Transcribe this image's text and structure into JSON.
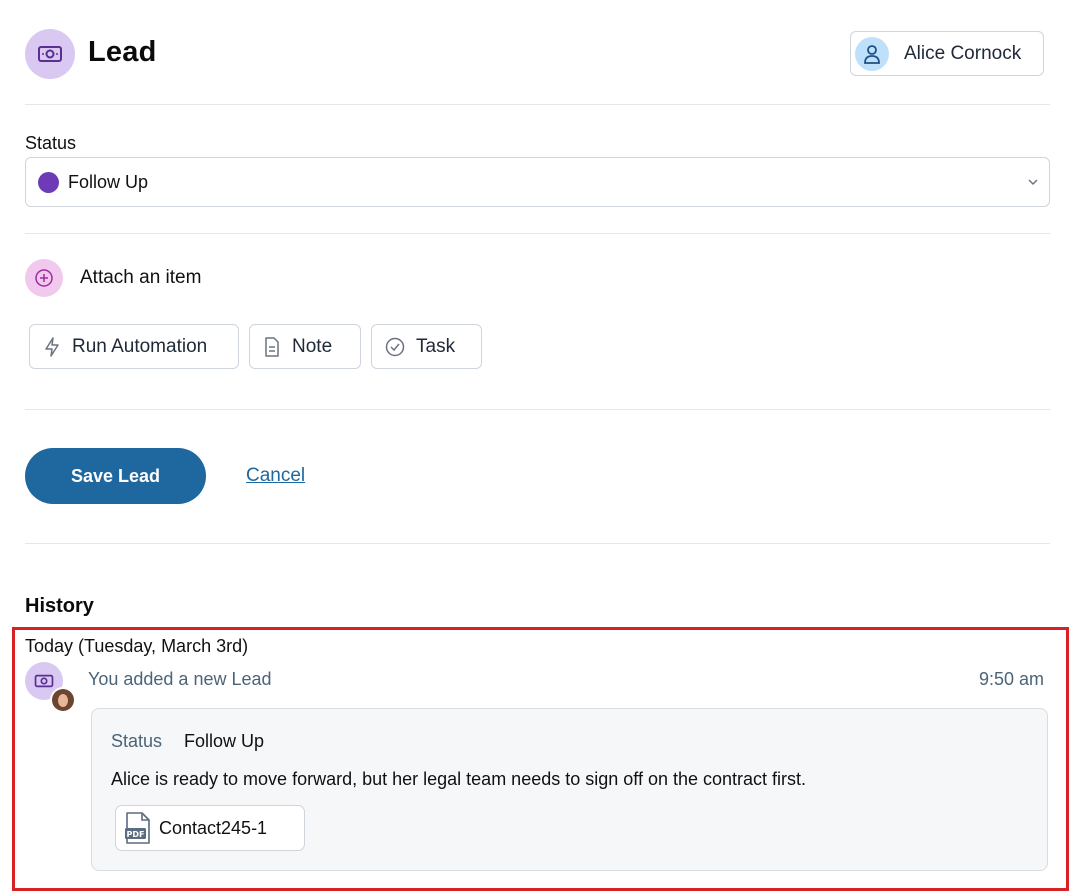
{
  "header": {
    "title": "Lead",
    "icon": "money-icon",
    "user_button": {
      "name": "Alice Cornock",
      "icon": "user-icon"
    }
  },
  "status": {
    "label": "Status",
    "value": "Follow Up",
    "dot_color": "#6d3bb5",
    "icon": "chevron-down-icon"
  },
  "attach": {
    "label": "Attach an item",
    "icon": "plus-circle-icon",
    "options": [
      {
        "label": "Run Automation",
        "icon": "lightning-icon"
      },
      {
        "label": "Note",
        "icon": "document-icon"
      },
      {
        "label": "Task",
        "icon": "check-circle-icon"
      }
    ]
  },
  "actions": {
    "save_label": "Save Lead",
    "cancel_label": "Cancel",
    "accent": "#1f679f"
  },
  "history": {
    "heading": "History",
    "date_label": "Today (Tuesday, March 3rd)",
    "entries": [
      {
        "text": "You added a new Lead",
        "time": "9:50 am",
        "icon": "money-icon",
        "status_key": "Status",
        "status_value": "Follow Up",
        "note": "Alice is ready to move forward, but her legal team needs to sign off on the contract first.",
        "attachment": {
          "name": "Contact245-1",
          "icon": "pdf-file-icon"
        }
      }
    ]
  }
}
